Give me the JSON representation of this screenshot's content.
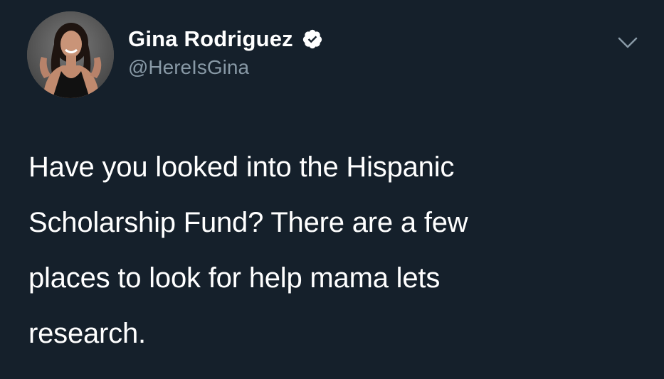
{
  "tweet": {
    "author": {
      "display_name": "Gina Rodriguez",
      "handle": "@HereIsGina",
      "verified": true,
      "avatar": "profile-photo"
    },
    "text": "Have you looked into the Hispanic\nScholarship Fund? There are a few\nplaces to look for help mama lets\nresearch.",
    "menu_icon": "chevron-down-icon"
  },
  "colors": {
    "background": "#15202b",
    "text": "#ffffff",
    "handle": "#8899a6",
    "verified_badge": "#ffffff"
  }
}
